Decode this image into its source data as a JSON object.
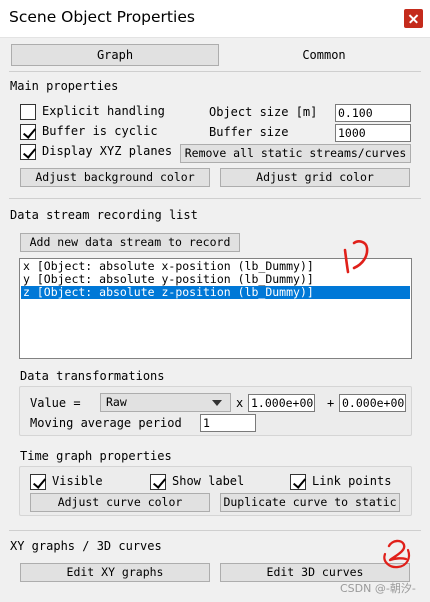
{
  "window": {
    "title": "Scene Object Properties",
    "close_icon": "close-icon"
  },
  "tabs": [
    {
      "label": "Graph",
      "active": true
    },
    {
      "label": "Common",
      "active": false
    }
  ],
  "main_properties": {
    "label": "Main properties",
    "explicit_handling": {
      "label": "Explicit handling",
      "checked": false
    },
    "buffer_is_cyclic": {
      "label": "Buffer is cyclic",
      "checked": true
    },
    "display_xyz_planes": {
      "label": "Display XYZ planes",
      "checked": true
    },
    "object_size_label": "Object size [m]",
    "object_size_value": "0.100",
    "buffer_size_label": "Buffer size",
    "buffer_size_value": "1000",
    "remove_all_button": "Remove all static streams/curves",
    "adjust_background_button": "Adjust background color",
    "adjust_grid_button": "Adjust grid color"
  },
  "data_stream": {
    "label": "Data stream recording list",
    "add_button": "Add new data stream to record",
    "items": [
      {
        "text": "x [Object: absolute x-position (lb_Dummy)]",
        "selected": false
      },
      {
        "text": "y [Object: absolute y-position (lb_Dummy)]",
        "selected": false
      },
      {
        "text": "z [Object: absolute z-position (lb_Dummy)]",
        "selected": true
      }
    ]
  },
  "data_transformations": {
    "label": "Data transformations",
    "value_label": "Value =",
    "value_select": "Raw",
    "mult_sign": "x",
    "mult_value": "1.000e+00",
    "plus_sign": "+",
    "add_value": "0.000e+00",
    "moving_avg_label": "Moving average period",
    "moving_avg_value": "1"
  },
  "time_graph": {
    "label": "Time graph properties",
    "visible": {
      "label": "Visible",
      "checked": true
    },
    "show_label": {
      "label": "Show label",
      "checked": true
    },
    "link_points": {
      "label": "Link points",
      "checked": true
    },
    "adjust_curve_button": "Adjust curve color",
    "duplicate_button": "Duplicate curve to static"
  },
  "xy_graphs": {
    "label": "XY graphs / 3D curves",
    "edit_xy_button": "Edit XY graphs",
    "edit_3d_button": "Edit 3D curves"
  },
  "annotations": {
    "mark_1": "1",
    "mark_2": "2",
    "color": "#e0201a"
  },
  "watermark": "CSDN @-朝汐-"
}
